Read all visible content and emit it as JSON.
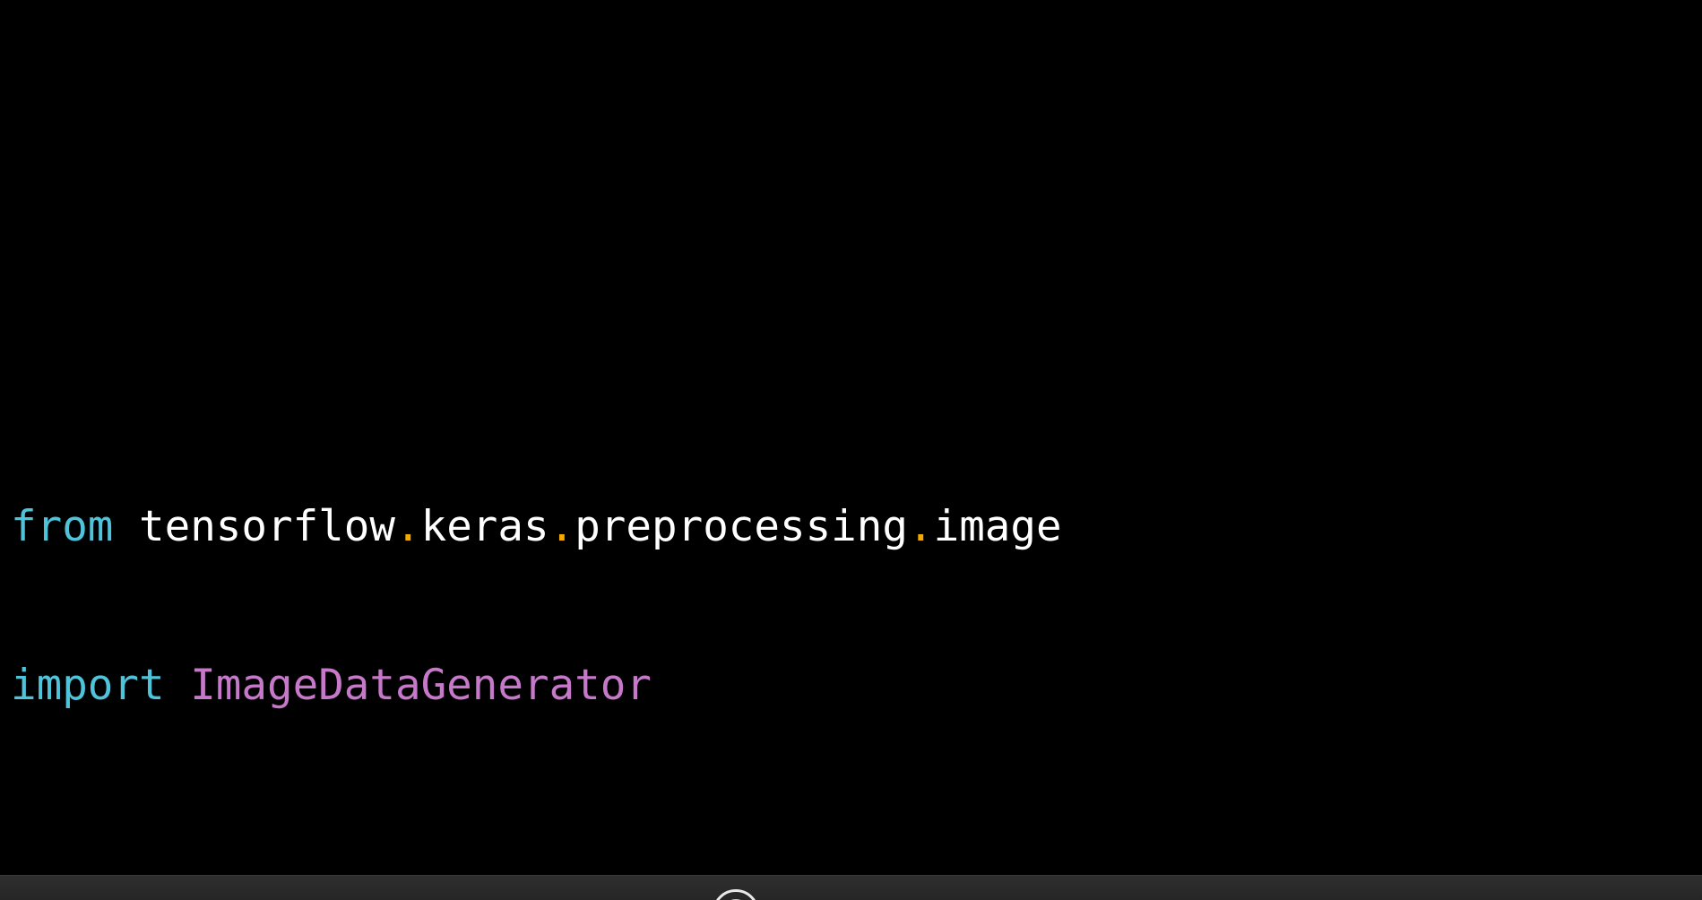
{
  "code": {
    "line1": {
      "keyword": "from",
      "space": " ",
      "module_part1": "tensorflow",
      "dot1": ".",
      "module_part2": "keras",
      "dot2": ".",
      "module_part3": "preprocessing",
      "dot3": ".",
      "module_part4": "image"
    },
    "line2": {
      "keyword": "import",
      "space": " ",
      "class_name": "ImageDataGenerator"
    }
  },
  "colors": {
    "background": "#000000",
    "keyword": "#4fc3d9",
    "identifier": "#ffffff",
    "dot": "#f2a900",
    "class_name": "#c678c9",
    "bottom_bar": "#2b2b2b"
  },
  "icons": {
    "bottom_center": "webcam-icon"
  }
}
